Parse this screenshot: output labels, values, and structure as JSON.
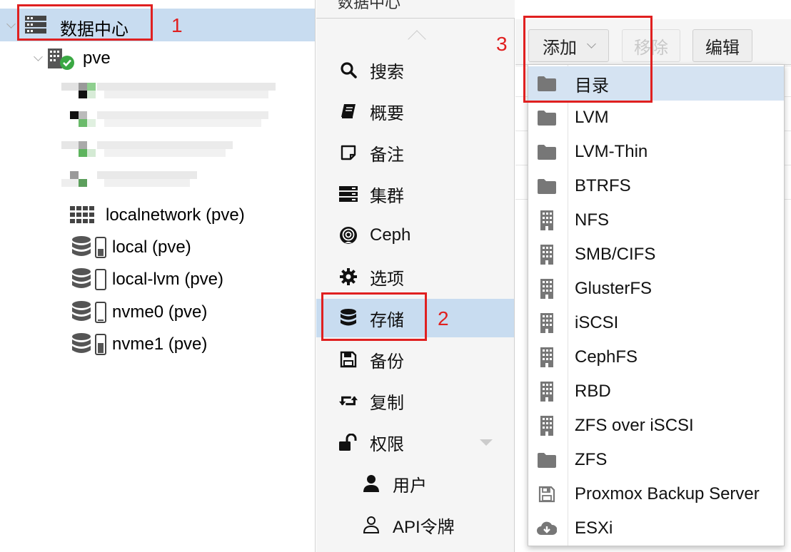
{
  "tree": {
    "datacenter_label": "数据中心",
    "node_label": "pve",
    "storages": [
      {
        "label": "localnetwork (pve)"
      },
      {
        "label": "local (pve)"
      },
      {
        "label": "local-lvm (pve)"
      },
      {
        "label": "nvme0 (pve)"
      },
      {
        "label": "nvme1 (pve)"
      }
    ]
  },
  "nav": {
    "header_title": "数据中心",
    "items": [
      {
        "label": "搜索",
        "icon": "search-icon"
      },
      {
        "label": "概要",
        "icon": "book-icon"
      },
      {
        "label": "备注",
        "icon": "note-icon"
      },
      {
        "label": "集群",
        "icon": "server-icon"
      },
      {
        "label": "Ceph",
        "icon": "ceph-icon"
      },
      {
        "label": "选项",
        "icon": "gear-icon"
      },
      {
        "label": "存储",
        "icon": "database-icon"
      },
      {
        "label": "备份",
        "icon": "floppy-icon"
      },
      {
        "label": "复制",
        "icon": "retweet-icon"
      },
      {
        "label": "权限",
        "icon": "unlock-icon"
      },
      {
        "label": "用户",
        "icon": "user-icon"
      },
      {
        "label": "API令牌",
        "icon": "user-outline-icon"
      }
    ],
    "active_item": "存储"
  },
  "toolbar": {
    "add_label": "添加",
    "remove_label": "移除",
    "edit_label": "编辑"
  },
  "menu": {
    "items": [
      {
        "label": "目录",
        "icon": "folder-icon"
      },
      {
        "label": "LVM",
        "icon": "folder-icon"
      },
      {
        "label": "LVM-Thin",
        "icon": "folder-icon"
      },
      {
        "label": "BTRFS",
        "icon": "folder-icon"
      },
      {
        "label": "NFS",
        "icon": "building-icon"
      },
      {
        "label": "SMB/CIFS",
        "icon": "building-icon"
      },
      {
        "label": "GlusterFS",
        "icon": "building-icon"
      },
      {
        "label": "iSCSI",
        "icon": "building-icon"
      },
      {
        "label": "CephFS",
        "icon": "building-icon"
      },
      {
        "label": "RBD",
        "icon": "building-icon"
      },
      {
        "label": "ZFS over iSCSI",
        "icon": "building-icon"
      },
      {
        "label": "ZFS",
        "icon": "folder-icon"
      },
      {
        "label": "Proxmox Backup Server",
        "icon": "floppy-outline-icon"
      },
      {
        "label": "ESXi",
        "icon": "cloud-download-icon"
      }
    ]
  },
  "annotations": {
    "n1": "1",
    "n2": "2",
    "n3": "3"
  },
  "colors": {
    "selection": "#c8dcf0",
    "annotation": "#e02020",
    "status_ok": "#3aa843"
  }
}
